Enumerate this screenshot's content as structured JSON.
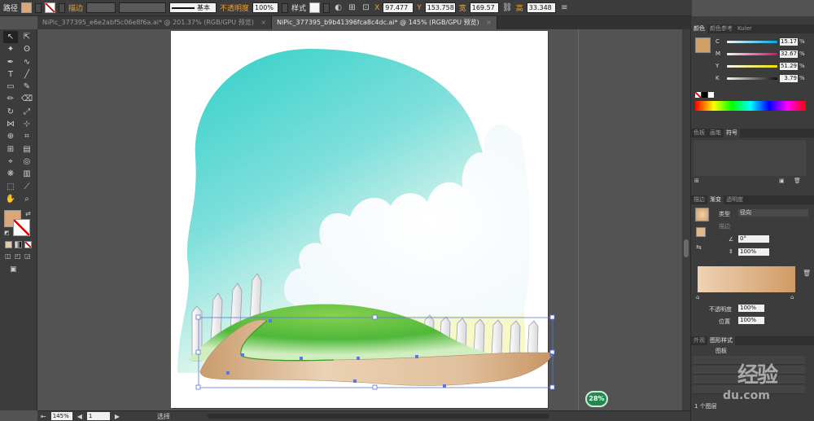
{
  "control_bar": {
    "object_type": "路径",
    "stroke_label": "描边",
    "opacity_label": "不透明度",
    "opacity_value": "100%",
    "style_label": "样式",
    "line_profile": "基本",
    "x_label": "X",
    "x_value": "97.477",
    "y_label": "Y",
    "y_value": "153.758",
    "w_label": "宽",
    "w_value": "169.57",
    "h_label": "高",
    "h_value": "33.348",
    "fill_color": "#d9a878"
  },
  "tabs": [
    {
      "label": "NiPic_377395_e6e2abf5c06e8f6a.ai* @ 201.37% (RGB/GPU 预览)",
      "close": "×"
    },
    {
      "label": "NiPic_377395_b9b41396fca8c4dc.ai* @ 145% (RGB/GPU 预览)",
      "close": "×"
    }
  ],
  "toolbar": {
    "fill_color": "#d9a878"
  },
  "status_bar": {
    "zoom": "145%",
    "artboard": "1",
    "tool": "选择"
  },
  "color_panel": {
    "tabs": [
      "颜色",
      "颜色参考",
      "Kuler"
    ],
    "swatch": "#d4a068",
    "channels": [
      {
        "name": "C",
        "value": "15.17",
        "grad": "linear-gradient(90deg,#f5f5f5,#00a8e0)"
      },
      {
        "name": "M",
        "value": "32.67",
        "grad": "linear-gradient(90deg,#f5f5f5,#e0007a)"
      },
      {
        "name": "Y",
        "value": "51.29",
        "grad": "linear-gradient(90deg,#f5f5f5,#f0e000)"
      },
      {
        "name": "K",
        "value": "3.79",
        "grad": "linear-gradient(90deg,#f5f5f5,#101010)"
      }
    ],
    "pct": "%"
  },
  "swatch_panel": {
    "tabs": [
      "色板",
      "画笔",
      "符号"
    ]
  },
  "gradient_panel": {
    "tabs": [
      "描边",
      "渐变",
      "透明度"
    ],
    "type_label": "类型",
    "type_value": "径向",
    "stroke_label": "描边",
    "angle_value": "0°",
    "ratio_value": "100%",
    "bar_from": "#eed3b4",
    "bar_to": "#d09a64",
    "opacity_label": "不透明度",
    "opacity_value": "100%",
    "position_label": "位置",
    "position_value": "100%"
  },
  "layers_panel": {
    "tabs": [
      "外观",
      "图形样式"
    ],
    "sub_label": "图板",
    "footer_label": "1 个图层"
  },
  "zoom_badge": "28%",
  "watermark": {
    "text": "经验",
    "domain": "du.com"
  }
}
